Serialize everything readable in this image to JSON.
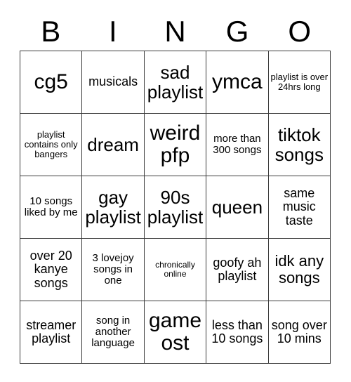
{
  "card": {
    "header_letters": [
      "B",
      "I",
      "N",
      "G",
      "O"
    ],
    "columns": 5,
    "rows": 5,
    "border_color": "#3a3a3a",
    "background_color": "#ffffff",
    "text_color": "#000000",
    "cells": [
      {
        "text": "cg5",
        "size": "fs-xxl"
      },
      {
        "text": "musicals",
        "size": "fs-md"
      },
      {
        "text": "sad playlist",
        "size": "fs-xl"
      },
      {
        "text": "ymca",
        "size": "fs-xxl"
      },
      {
        "text": "playlist is over 24hrs long",
        "size": "fs-xs"
      },
      {
        "text": "playlist contains only bangers",
        "size": "fs-xs"
      },
      {
        "text": "dream",
        "size": "fs-xl"
      },
      {
        "text": "weird pfp",
        "size": "fs-xxl"
      },
      {
        "text": "more than 300 songs",
        "size": "fs-sm"
      },
      {
        "text": "tiktok songs",
        "size": "fs-xl"
      },
      {
        "text": "10 songs liked by me",
        "size": "fs-sm"
      },
      {
        "text": "gay playlist",
        "size": "fs-xl"
      },
      {
        "text": "90s playlist",
        "size": "fs-xl"
      },
      {
        "text": "queen",
        "size": "fs-xl"
      },
      {
        "text": "same music taste",
        "size": "fs-md"
      },
      {
        "text": "over 20 kanye songs",
        "size": "fs-md"
      },
      {
        "text": "3 lovejoy songs in one",
        "size": "fs-sm"
      },
      {
        "text": "chronically online",
        "size": "fs-xxs"
      },
      {
        "text": "goofy ah playlist",
        "size": "fs-md"
      },
      {
        "text": "idk any songs",
        "size": "fs-lg"
      },
      {
        "text": "streamer playlist",
        "size": "fs-md"
      },
      {
        "text": "song in another language",
        "size": "fs-sm"
      },
      {
        "text": "game ost",
        "size": "fs-xxl"
      },
      {
        "text": "less than 10 songs",
        "size": "fs-md"
      },
      {
        "text": "song over 10 mins",
        "size": "fs-md"
      }
    ]
  }
}
